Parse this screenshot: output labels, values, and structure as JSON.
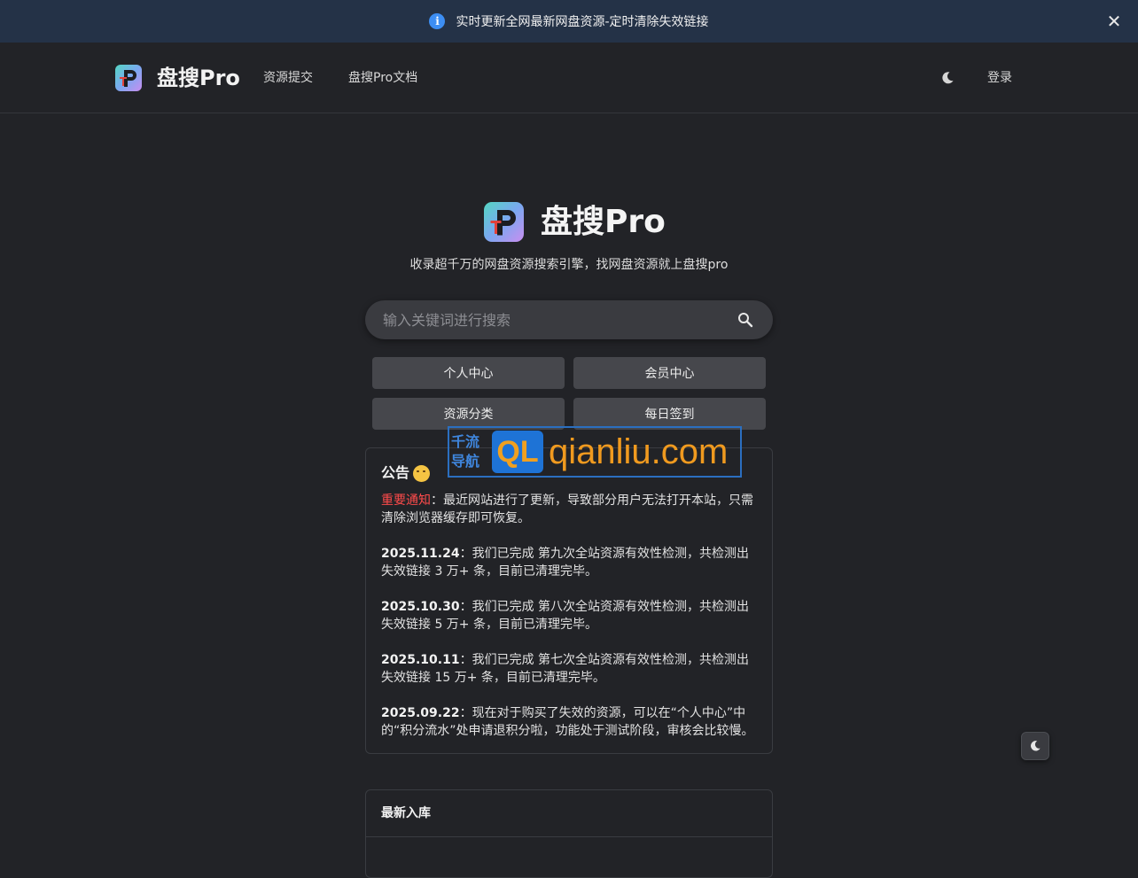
{
  "banner": {
    "text": "实时更新全网最新网盘资源-定时清除失效链接",
    "info_glyph": "i",
    "close_glyph": "✕"
  },
  "nav": {
    "brand": "盘搜Pro",
    "links": [
      "资源提交",
      "盘搜Pro文档"
    ],
    "login": "登录"
  },
  "hero": {
    "title": "盘搜Pro",
    "subtitle": "收录超千万的网盘资源搜索引擎，找网盘资源就上盘搜pro"
  },
  "search": {
    "placeholder": "输入关键词进行搜索"
  },
  "quick_buttons": [
    "个人中心",
    "会员中心",
    "资源分类",
    "每日签到"
  ],
  "notice": {
    "title": "公告",
    "important_label": "重要通知",
    "important_text": "：最近网站进行了更新，导致部分用户无法打开本站，只需清除浏览器缓存即可恢复。",
    "items": [
      {
        "date": "2025.11.24",
        "text": "：我们已完成 第九次全站资源有效性检测，共检测出失效链接 3 万+ 条，目前已清理完毕。"
      },
      {
        "date": "2025.10.30",
        "text": "：我们已完成 第八次全站资源有效性检测，共检测出失效链接 5 万+ 条，目前已清理完毕。"
      },
      {
        "date": "2025.10.11",
        "text": "：我们已完成 第七次全站资源有效性检测，共检测出失效链接 15 万+ 条，目前已清理完毕。"
      },
      {
        "date": "2025.09.22",
        "text": "：现在对于购买了失效的资源，可以在“个人中心”中的“积分流水”处申请退积分啦，功能处于测试阶段，审核会比较慢。"
      }
    ]
  },
  "latest": {
    "title": "最新入库"
  },
  "watermark": {
    "cn_line1": "千流",
    "cn_line2": "导航",
    "badge": "QL",
    "url": "qianliu.com"
  },
  "colors": {
    "background": "#222327",
    "banner": "#243247",
    "important": "#ff4b4b",
    "info": "#3d8ef3"
  },
  "icons": [
    "info-icon",
    "close-icon",
    "logo-icon",
    "moon-icon",
    "search-icon"
  ]
}
